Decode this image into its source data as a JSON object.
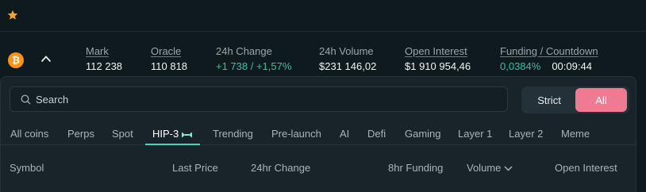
{
  "topbar": {
    "favorite_icon": "star-icon",
    "star_color": "#f5a623"
  },
  "ticker": {
    "coin_icon": "bitcoin-icon",
    "stats": {
      "mark": {
        "label": "Mark",
        "value": "112 238"
      },
      "oracle": {
        "label": "Oracle",
        "value": "110 818"
      },
      "change": {
        "label": "24h Change",
        "value": "+1 738 / +1,57%"
      },
      "volume": {
        "label": "24h Volume",
        "value": "$231 146,02"
      },
      "open_interest": {
        "label": "Open Interest",
        "value": "$1 910 954,46"
      },
      "funding": {
        "label": "Funding / Countdown",
        "rate": "0,0384%",
        "countdown": "00:09:44"
      }
    }
  },
  "panel": {
    "search": {
      "placeholder": "Search",
      "value": ""
    },
    "filter": {
      "strict_label": "Strict",
      "all_label": "All",
      "selected": "All"
    },
    "tabs": [
      {
        "label": "All coins"
      },
      {
        "label": "Perps"
      },
      {
        "label": "Spot"
      },
      {
        "label": "HIP-3"
      },
      {
        "label": "Trending"
      },
      {
        "label": "Pre-launch"
      },
      {
        "label": "AI"
      },
      {
        "label": "Defi"
      },
      {
        "label": "Gaming"
      },
      {
        "label": "Layer 1"
      },
      {
        "label": "Layer 2"
      },
      {
        "label": "Meme"
      }
    ],
    "active_tab": "HIP-3",
    "columns": {
      "symbol": "Symbol",
      "last_price": "Last Price",
      "change": "24hr Change",
      "funding": "8hr Funding",
      "volume": "Volume",
      "open_interest": "Open Interest"
    }
  },
  "colors": {
    "accent_green": "#36c29a",
    "accent_pink": "#f07a92",
    "tab_underline": "#4fd1b5"
  }
}
